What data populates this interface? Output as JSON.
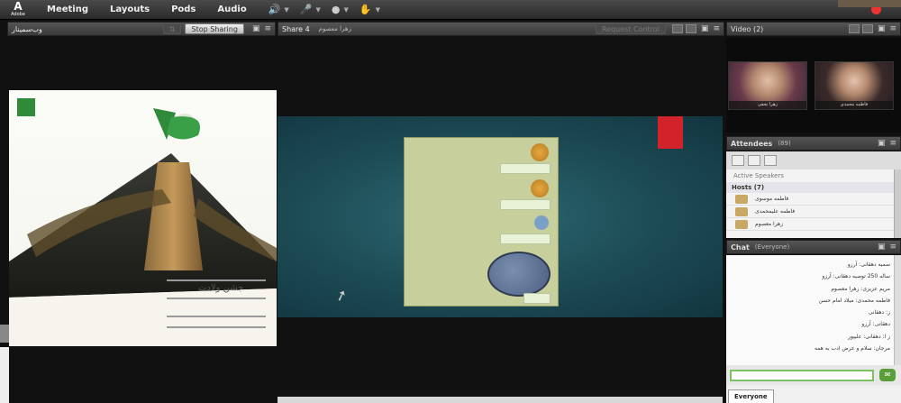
{
  "menubar": {
    "logo": "Adobe",
    "menus": [
      "Meeting",
      "Layouts",
      "Pods",
      "Audio"
    ]
  },
  "left_pod": {
    "title": "وب‌سمینار",
    "stop_sharing": "Stop Sharing",
    "poster_caption": "جشن ولادت"
  },
  "share_pod": {
    "title": "Share 4",
    "subtitle": "زهرا معصوم",
    "request_control": "Request Control"
  },
  "video_pod": {
    "title": "Video (2)",
    "tiles": [
      {
        "name": "زهرا نجفی"
      },
      {
        "name": "فاطمه محمدی"
      }
    ]
  },
  "attendees": {
    "title": "Attendees",
    "count": "(89)",
    "active_speakers": "Active Speakers",
    "hosts_label": "Hosts (7)",
    "hosts": [
      "فاطمه موسوی",
      "فاطمه علیمحمدی",
      "زهرا معصوم"
    ]
  },
  "chat": {
    "title": "Chat",
    "scope": "(Everyone)",
    "messages": [
      "سمیه دهقانی: آرزو",
      "ساله 250 توصیه دهقانی: آرزو",
      "مریم عزیزی: زهرا معصوم",
      "فاطمه محمدی: میلاد امام حسن",
      "ز: دهقانی",
      "دهقانی: آرزو",
      "ز ا: دهقانی: علیپور",
      "مرجان: سلام و عرض ادب به همه"
    ],
    "tab_everyone": "Everyone"
  },
  "colors": {
    "accent_green": "#7dc262",
    "share_red": "#d2232a",
    "share_bg": "#1c4a53"
  }
}
